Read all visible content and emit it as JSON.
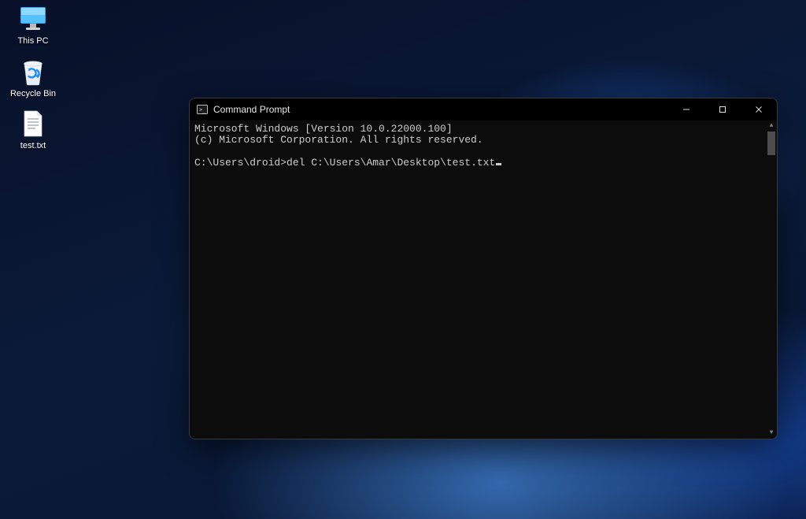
{
  "desktop": {
    "icons": [
      {
        "label": "This PC"
      },
      {
        "label": "Recycle Bin"
      },
      {
        "label": "test.txt"
      }
    ]
  },
  "window": {
    "title": "Command Prompt",
    "lines": {
      "version": "Microsoft Windows [Version 10.0.22000.100]",
      "copyright": "(c) Microsoft Corporation. All rights reserved.",
      "prompt": "C:\\Users\\droid>",
      "command": "del C:\\Users\\Amar\\Desktop\\test.txt"
    }
  }
}
